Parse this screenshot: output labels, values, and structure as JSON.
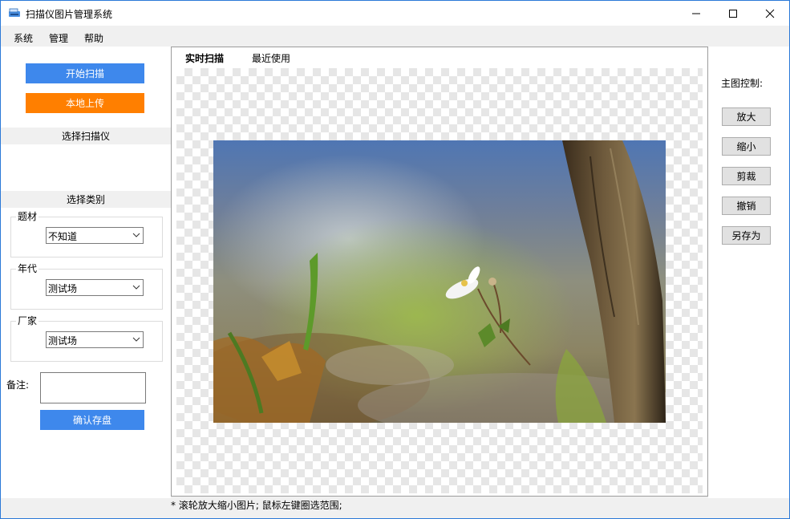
{
  "window": {
    "title": "扫描仪图片管理系统"
  },
  "menu": [
    "系统",
    "管理",
    "帮助"
  ],
  "left": {
    "start_scan": "开始扫描",
    "local_upload": "本地上传",
    "select_scanner": "选择扫描仪",
    "select_category": "选择类别",
    "groups": [
      {
        "label": "题材",
        "value": "不知道"
      },
      {
        "label": "年代",
        "value": "测试场"
      },
      {
        "label": "厂家",
        "value": "测试场"
      }
    ],
    "notes_label": "备注:",
    "notes_value": "",
    "confirm_save": "确认存盘"
  },
  "tabs": [
    "实时扫描",
    "最近使用"
  ],
  "right": {
    "title": "主图控制:",
    "buttons": [
      "放大",
      "缩小",
      "剪裁",
      "撤销",
      "另存为"
    ]
  },
  "status": "* 滚轮放大缩小图片; 鼠标左键圈选范围;",
  "colors": {
    "primary_blue": "#3e88ec",
    "accent_orange": "#ff7f00",
    "window_border": "#2b79d8"
  }
}
